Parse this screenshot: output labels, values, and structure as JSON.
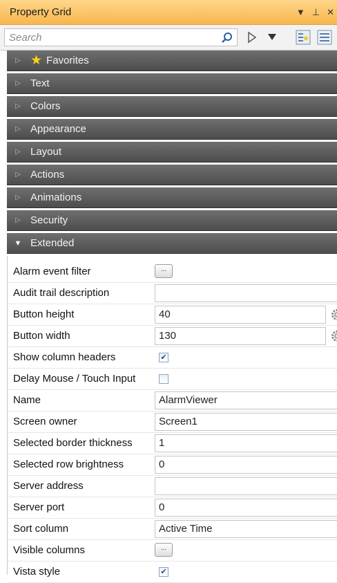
{
  "panel": {
    "title": "Property Grid",
    "dropdown_glyph": "▼",
    "pin_glyph": "⊥",
    "close_glyph": "✕"
  },
  "search": {
    "placeholder": "Search",
    "value": ""
  },
  "toolbar": {
    "icons": [
      "search-icon",
      "expand-arrow-icon",
      "dropdown-icon",
      "categorized-view-icon",
      "alphabetical-view-icon"
    ]
  },
  "categories": [
    {
      "label": "Favorites",
      "expanded": false,
      "icon": "star-icon"
    },
    {
      "label": "Text",
      "expanded": false
    },
    {
      "label": "Colors",
      "expanded": false
    },
    {
      "label": "Appearance",
      "expanded": false
    },
    {
      "label": "Layout",
      "expanded": false
    },
    {
      "label": "Actions",
      "expanded": false
    },
    {
      "label": "Animations",
      "expanded": false
    },
    {
      "label": "Security",
      "expanded": false
    },
    {
      "label": "Extended",
      "expanded": true
    }
  ],
  "properties": [
    {
      "name": "Alarm event filter",
      "editor": "ellipsis",
      "button_label": "..."
    },
    {
      "name": "Audit trail description",
      "editor": "text",
      "value": ""
    },
    {
      "name": "Button height",
      "editor": "text",
      "value": "40",
      "has_gear": true
    },
    {
      "name": "Button width",
      "editor": "text",
      "value": "130",
      "has_gear": true
    },
    {
      "name": "Show column headers",
      "editor": "checkbox",
      "checked": true,
      "mark": "✔"
    },
    {
      "name": "Delay Mouse / Touch Input",
      "editor": "checkbox",
      "checked": false,
      "mark": ""
    },
    {
      "name": "Name",
      "editor": "text",
      "value": "AlarmViewer"
    },
    {
      "name": "Screen owner",
      "editor": "text",
      "value": "Screen1"
    },
    {
      "name": "Selected border thickness",
      "editor": "text",
      "value": "1"
    },
    {
      "name": "Selected row brightness",
      "editor": "text",
      "value": "0"
    },
    {
      "name": "Server address",
      "editor": "text",
      "value": ""
    },
    {
      "name": "Server port",
      "editor": "text",
      "value": "0"
    },
    {
      "name": "Sort column",
      "editor": "text",
      "value": "Active Time"
    },
    {
      "name": "Visible columns",
      "editor": "ellipsis",
      "button_label": "..."
    },
    {
      "name": "Vista style",
      "editor": "checkbox",
      "checked": true,
      "mark": "✔"
    }
  ],
  "colors": {
    "titlebar": "#f8b64c",
    "category_bg": "#5a5a5a",
    "category_text": "#f2f2f2",
    "star": "#ffd21a"
  }
}
